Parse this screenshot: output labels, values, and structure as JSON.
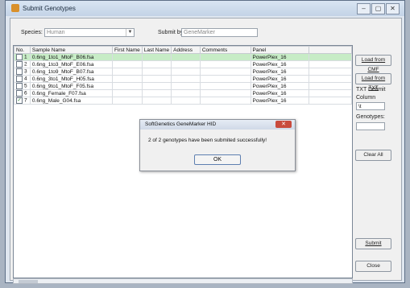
{
  "window": {
    "title": "Submit Genotypes",
    "controls": [
      "‒",
      "▢",
      "✕"
    ]
  },
  "filters": {
    "species_label": "Species:",
    "species_value": "Human",
    "submit_by_label": "Submit by:",
    "submit_by_value": "GeneMarker"
  },
  "table": {
    "columns": [
      "No.",
      "Sample Name",
      "First Name",
      "Last Name",
      "Address",
      "Comments",
      "Panel",
      ""
    ],
    "rows": [
      {
        "no": "1",
        "sample": "0.6ng_1to1_MtoF_B06.fsa",
        "panel": "PowerPlex_16",
        "checked": false,
        "selected": true
      },
      {
        "no": "2",
        "sample": "0.6ng_1to3_MtoF_E06.fsa",
        "panel": "PowerPlex_16",
        "checked": false,
        "selected": false
      },
      {
        "no": "3",
        "sample": "0.6ng_1to9_MtoF_B07.fsa",
        "panel": "PowerPlex_16",
        "checked": false,
        "selected": false
      },
      {
        "no": "4",
        "sample": "0.6ng_3to1_MtoF_H05.fsa",
        "panel": "PowerPlex_16",
        "checked": false,
        "selected": false
      },
      {
        "no": "5",
        "sample": "0.6ng_9to1_MtoF_F05.fsa",
        "panel": "PowerPlex_16",
        "checked": false,
        "selected": false
      },
      {
        "no": "6",
        "sample": "0.6ng_Female_F07.fsa",
        "panel": "PowerPlex_16",
        "checked": false,
        "selected": false
      },
      {
        "no": "7",
        "sample": "0.6ng_Male_G04.fsa",
        "panel": "PowerPlex_16",
        "checked": true,
        "selected": false
      }
    ]
  },
  "side": {
    "load_cmf": "Load from CMF",
    "load_txt": "Load from TXT",
    "txt_delimit": "TXT Delimit",
    "column_label": "Column",
    "column_value": "\\t",
    "genotypes_label": "Genotypes:",
    "genotypes_value": "",
    "clear_all": "Clear All",
    "submit": "Submit",
    "close": "Close"
  },
  "dialog": {
    "title": "SoftGenetics GeneMarker HID",
    "message": "2 of 2 genotypes have been submited successfully!",
    "ok": "OK"
  },
  "colors": {
    "selected_row": "#c7ecc6",
    "close_button": "#c94b3d",
    "window_background": "#dfe6ef"
  }
}
